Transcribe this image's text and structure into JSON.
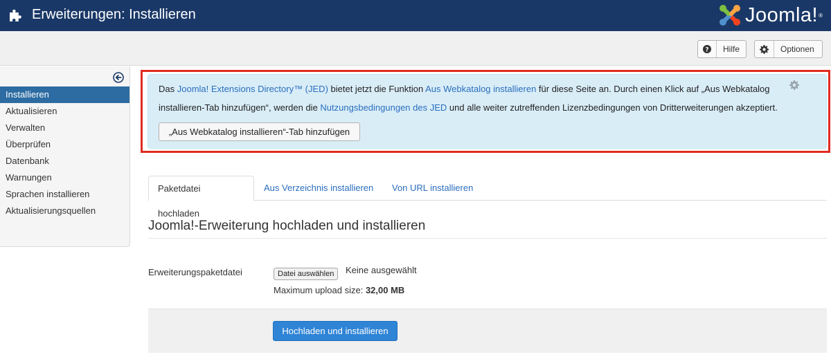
{
  "header": {
    "title": "Erweiterungen: Installieren",
    "title_icon": "puzzle-piece-icon",
    "logo": {
      "text": "Joomla!",
      "registered": "®"
    }
  },
  "toolbar": {
    "help": {
      "label": "Hilfe",
      "icon": "question-circle-icon"
    },
    "options": {
      "label": "Optionen",
      "icon": "gear-icon"
    }
  },
  "sidebar": {
    "collapse_icon": "arrow-left-circle-icon",
    "items": [
      {
        "label": "Installieren",
        "active": true
      },
      {
        "label": "Aktualisieren"
      },
      {
        "label": "Verwalten"
      },
      {
        "label": "Überprüfen"
      },
      {
        "label": "Datenbank"
      },
      {
        "label": "Warnungen"
      },
      {
        "label": "Sprachen installieren"
      },
      {
        "label": "Aktualisierungsquellen"
      }
    ]
  },
  "jed_message": {
    "line1": {
      "t1": "Das ",
      "link1": "Joomla! Extensions Directory™ (JED)",
      "t2": " bietet jetzt die Funktion ",
      "link2": "Aus Webkatalog installieren",
      "t3": " für diese Seite an. Durch einen Klick auf „Aus Webkatalog"
    },
    "line2": {
      "t1": "installieren-Tab hinzufügen“, werden die ",
      "link": "Nutzungsbedingungen des JED",
      "t2": " und alle weiter zutreffenden Lizenzbedingungen von Dritterweiterungen akzeptiert."
    },
    "button": "„Aus Webkatalog installieren“-Tab hinzufügen",
    "dismiss_icon": "gear-icon"
  },
  "tabs": [
    {
      "label": "Paketdatei hochladen",
      "active": true
    },
    {
      "label": "Aus Verzeichnis installieren"
    },
    {
      "label": "Von URL installieren"
    }
  ],
  "upload": {
    "heading": "Joomla!-Erweiterung hochladen und installieren",
    "field_label": "Erweiterungspaketdatei",
    "file_button": "Datei auswählen",
    "file_status": "Keine ausgewählt",
    "max_size_label": "Maximum upload size: ",
    "max_size_value": "32,00 MB",
    "submit": "Hochladen und installieren"
  },
  "colors": {
    "header_bg": "#1a3867",
    "active_item": "#2d6ca2",
    "link": "#2a6ebd",
    "alert_bg": "#d9edf7",
    "highlight_frame": "#e02b20",
    "primary_button": "#2f84d6"
  }
}
